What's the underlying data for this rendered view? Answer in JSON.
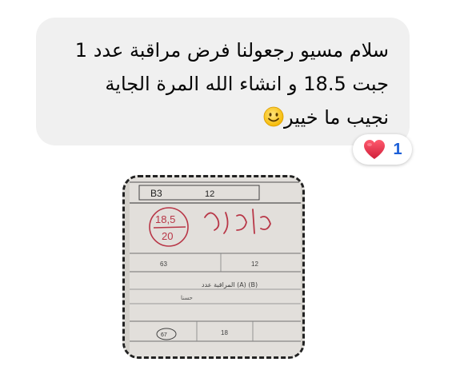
{
  "message": {
    "line1": "سلام مسيو رجعولنا فرض مراقبة عدد 1",
    "line2": "جبت 18.5 و انشاء الله المرة الجاية",
    "line3": "نجيب ما خيير",
    "emoji": "smiling-face-icon"
  },
  "reaction": {
    "icon": "heart-icon",
    "count": "1",
    "heart_color": "#e8304a",
    "count_color": "#1b5fd8"
  },
  "attachment": {
    "type": "photo of graded exam paper",
    "paper": {
      "header_left": "B3",
      "header_mid": "12",
      "grade_numerator": "18,5",
      "grade_denominator": "20",
      "grade_comment": "حسن جدا",
      "row_a_left": "63",
      "row_a_right": "12",
      "row_b_text": "المراقبة عدد (A) (B)",
      "row_b_sub": "حسنا",
      "row_c_left": "67",
      "row_c_right": "18"
    },
    "ink_color": "#c0394a"
  }
}
